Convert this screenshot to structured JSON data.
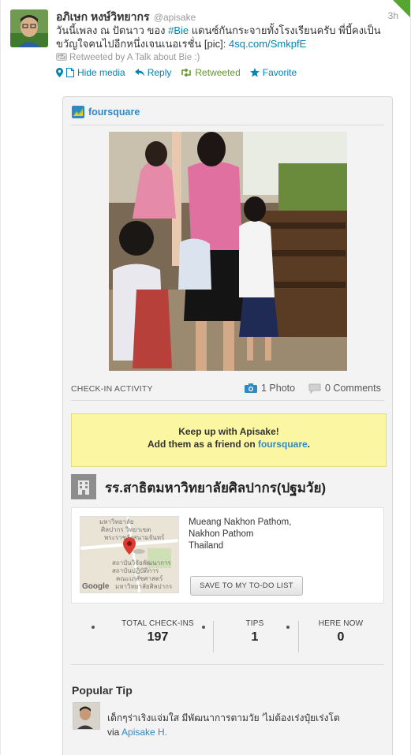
{
  "tweet": {
    "fullname": "อภิเษก หงษ์วิทยากร",
    "screen_name": "@apisake",
    "time": "3h",
    "text_line1_before": "วันนี้เพลง ณ ปัตนาว ของ ",
    "hashtag": "#Bie",
    "text_line1_after": " แดนซ์กันกระจายทั้งโรงเรียนครับ พี่บี้คงเป็น",
    "text_line2": "ขวัญใจคนไปอีกหนึ่งเจนเนอเรชั่น [pic]: ",
    "link": "4sq.com/SmkpfE",
    "retweeted_by": "Retweeted by A Talk about Bie :)",
    "actions": {
      "hide_media": "Hide media",
      "reply": "Reply",
      "retweeted": "Retweeted",
      "favorite": "Favorite"
    }
  },
  "card": {
    "brand": "foursquare",
    "checkin_label": "CHECK-IN ACTIVITY",
    "photo_count": "1 Photo",
    "comment_count": "0 Comments",
    "promo_line1": "Keep up with Apisake!",
    "promo_line2_before": "Add them as a friend on ",
    "promo_link": "foursquare",
    "promo_line2_after": ".",
    "venue_name": "รร.สาธิตมหาวิทยาลัยศิลปากร(ปฐมวัย)",
    "address": [
      "Mueang Nakhon Pathom,",
      "Nakhon Pathom",
      "Thailand"
    ],
    "todo_button": "SAVE TO MY TO-DO LIST",
    "map_labels": [
      "มหาวิทยาลัย",
      "ศิลปากร วิทยาเขต",
      "พระราชวังสนามจันทร์",
      "สถาบันวิจัยพัฒนาการ",
      "สถาบันปฏิบัติการ",
      "คณะเภสัชศาสตร์",
      "มหาวิทยาลัยศิลปากร"
    ],
    "map_brand": "Google",
    "stats": [
      {
        "label": "TOTAL CHECK-INS",
        "value": "197"
      },
      {
        "label": "TIPS",
        "value": "1"
      },
      {
        "label": "HERE NOW",
        "value": "0"
      }
    ],
    "popular_tip_title": "Popular Tip",
    "tip_text": "เด็กๆร่าเริงแจ่มใส มีพัฒนาการตามวัย 'ไม่ต้องเร่งปุ๋ยเร่งโต",
    "tip_via": "via ",
    "tip_author": "Apisake H."
  },
  "colors": {
    "link": "#0084b4",
    "retweet_green": "#609928",
    "foursquare_blue": "#2d8ac7",
    "promo_yellow": "#fbf6a1"
  },
  "icons": [
    "location-pin-icon",
    "document-icon",
    "reply-arrow-icon",
    "retweet-icon",
    "star-icon",
    "camera-icon",
    "comment-bubble-icon",
    "building-icon",
    "map-marker-icon"
  ]
}
